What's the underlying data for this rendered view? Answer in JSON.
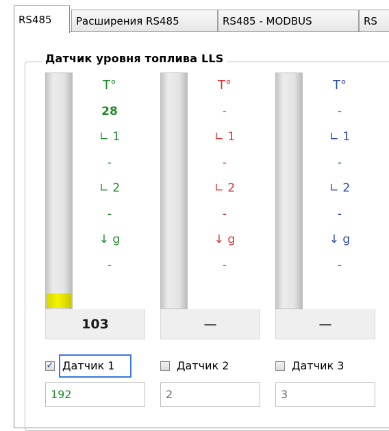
{
  "tabs": [
    {
      "label": "RS485",
      "active": true
    },
    {
      "label": "Расширения RS485",
      "active": false
    },
    {
      "label": "RS485 - MODBUS",
      "active": false
    },
    {
      "label": "RS",
      "active": false
    }
  ],
  "group": {
    "title": "Датчик уровня топлива LLS"
  },
  "sensors": [
    {
      "color": "#1f8a2a",
      "temp_icon": "Т°",
      "temperature": "28",
      "level1_label": "∟ 1",
      "level1_value": "-",
      "level2_label": "∟ 2",
      "level2_value": "-",
      "density_label": "↓ g",
      "density_value": "-",
      "level_fraction": 0.06,
      "readout": "103",
      "checkbox_label": "Датчик 1",
      "checked": true,
      "field_value": "192",
      "field_color": "#1f8a2a"
    },
    {
      "color": "#e03030",
      "temp_icon": "Т°",
      "temperature": "-",
      "level1_label": "∟ 1",
      "level1_value": "-",
      "level2_label": "∟ 2",
      "level2_value": "-",
      "density_label": "↓ g",
      "density_value": "-",
      "level_fraction": 0,
      "readout": "—",
      "checkbox_label": "Датчик 2",
      "checked": false,
      "field_value": "2",
      "field_color": "#6b6b6b"
    },
    {
      "color": "#2a4aa0",
      "temp_icon": "Т°",
      "temperature": "-",
      "level1_label": "∟ 1",
      "level1_value": "-",
      "level2_label": "∟ 2",
      "level2_value": "-",
      "density_label": "↓ g",
      "density_value": "-",
      "level_fraction": 0,
      "readout": "—",
      "checkbox_label": "Датчик 3",
      "checked": false,
      "field_value": "3",
      "field_color": "#6b6b6b"
    }
  ]
}
